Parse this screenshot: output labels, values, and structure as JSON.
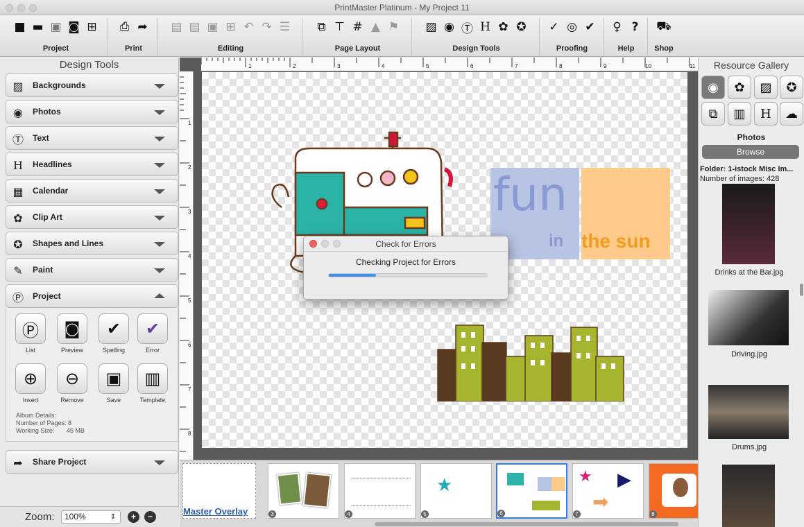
{
  "window": {
    "title": "PrintMaster Platinum - My Project 11"
  },
  "toolbar": {
    "groups": [
      {
        "label": "Project"
      },
      {
        "label": "Print"
      },
      {
        "label": "Editing"
      },
      {
        "label": "Page Layout"
      },
      {
        "label": "Design Tools"
      },
      {
        "label": "Proofing"
      },
      {
        "label": "Help"
      },
      {
        "label": "Shop"
      }
    ]
  },
  "design_tools": {
    "title": "Design Tools",
    "items": [
      {
        "label": "Backgrounds",
        "icon": "image-icon"
      },
      {
        "label": "Photos",
        "icon": "camera-icon"
      },
      {
        "label": "Text",
        "icon": "text-icon"
      },
      {
        "label": "Headlines",
        "icon": "headline-icon"
      },
      {
        "label": "Calendar",
        "icon": "calendar-icon"
      },
      {
        "label": "Clip Art",
        "icon": "clipart-icon"
      },
      {
        "label": "Shapes and Lines",
        "icon": "star-icon"
      },
      {
        "label": "Paint",
        "icon": "brush-icon"
      },
      {
        "label": "Project",
        "icon": "project-icon"
      }
    ],
    "share_label": "Share Project",
    "project_buttons": [
      {
        "label": "List"
      },
      {
        "label": "Preview"
      },
      {
        "label": "Spelling"
      },
      {
        "label": "Error"
      },
      {
        "label": "Insert"
      },
      {
        "label": "Remove"
      },
      {
        "label": "Save"
      },
      {
        "label": "Template"
      }
    ],
    "album": {
      "title": "Album Details:",
      "pages": "Number of Pages: 8",
      "working_size_label": "Working Size:",
      "working_size": "45 MB"
    }
  },
  "zoom": {
    "label": "Zoom:",
    "value": "100%"
  },
  "ruler": {
    "marks": [
      "1",
      "2",
      "3",
      "4",
      "5",
      "6",
      "7",
      "8",
      "9",
      "10",
      "11"
    ],
    "vmarks": [
      "1",
      "2",
      "3",
      "4",
      "5",
      "6",
      "7",
      "8"
    ]
  },
  "canvas": {
    "fun_text": "fun",
    "in_text": "in",
    "sun_text": "the sun"
  },
  "dialog": {
    "title": "Check for Errors",
    "message": "Checking Project for Errors",
    "progress": 0.3
  },
  "filmstrip": {
    "master_label": "Master Overlay",
    "pages": [
      "3",
      "4",
      "5",
      "6",
      "7",
      "8"
    ]
  },
  "resource_gallery": {
    "title": "Resource Gallery",
    "section": "Photos",
    "browse_label": "Browse",
    "folder": "Folder: 1-istock Misc Im...",
    "count": "Number of images: 428",
    "images": [
      {
        "caption": "Drinks at the Bar.jpg"
      },
      {
        "caption": "Driving.jpg"
      },
      {
        "caption": "Drums.jpg"
      }
    ]
  }
}
